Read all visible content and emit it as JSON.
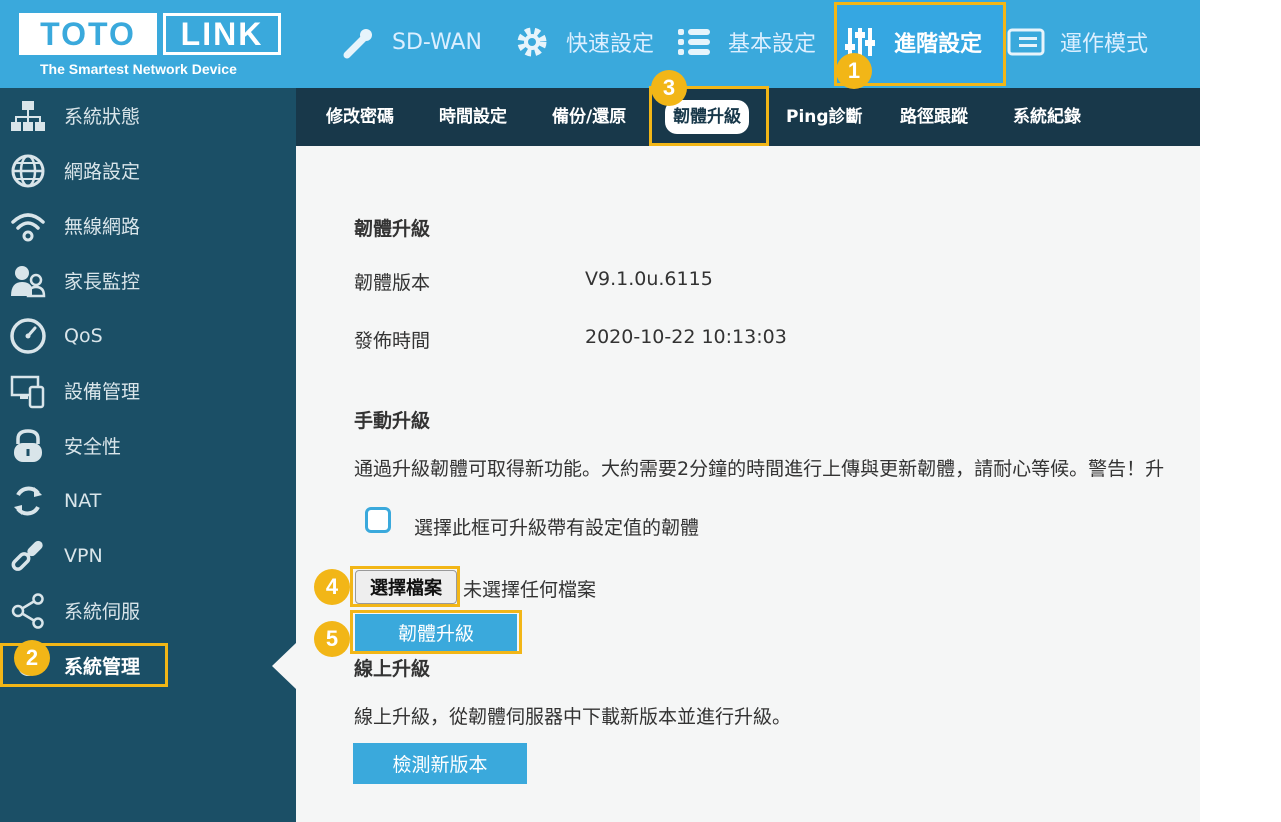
{
  "brand": {
    "logo_left": "TOTO",
    "logo_right": "LINK",
    "tagline": "The Smartest Network Device"
  },
  "topnav": [
    {
      "label": "SD-WAN",
      "icon": "wrench-icon"
    },
    {
      "label": "快速設定",
      "icon": "gear-icon"
    },
    {
      "label": "基本設定",
      "icon": "list-icon"
    },
    {
      "label": "進階設定",
      "icon": "sliders-icon",
      "active": true
    },
    {
      "label": "運作模式",
      "icon": "card-icon"
    }
  ],
  "subnav": [
    {
      "label": "修改密碼"
    },
    {
      "label": "時間設定"
    },
    {
      "label": "備份/還原"
    },
    {
      "label": "韌體升級",
      "active": true
    },
    {
      "label": "Ping診斷"
    },
    {
      "label": "路徑跟蹤"
    },
    {
      "label": "系統紀錄"
    }
  ],
  "sidebar": [
    {
      "label": "系統狀態",
      "icon": "network-icon"
    },
    {
      "label": "網路設定",
      "icon": "globe-icon"
    },
    {
      "label": "無線網路",
      "icon": "wifi-icon"
    },
    {
      "label": "家長監控",
      "icon": "parental-icon"
    },
    {
      "label": "QoS",
      "icon": "gauge-icon"
    },
    {
      "label": "設備管理",
      "icon": "devices-icon"
    },
    {
      "label": "安全性",
      "icon": "lock-icon"
    },
    {
      "label": "NAT",
      "icon": "refresh-icon"
    },
    {
      "label": "VPN",
      "icon": "link-icon"
    },
    {
      "label": "系統伺服",
      "icon": "share-icon"
    },
    {
      "label": "系統管理",
      "icon": "admin-icon",
      "active": true
    }
  ],
  "firmware": {
    "section_title": "韌體升級",
    "version_label": "韌體版本",
    "version_value": "V9.1.0u.6115",
    "date_label": "發佈時間",
    "date_value": "2020-10-22 10:13:03"
  },
  "manual": {
    "section_title": "手動升級",
    "description": "通過升級韌體可取得新功能。大約需要2分鐘的時間進行上傳與更新韌體，請耐心等候。警告！升",
    "checkbox_label": "選擇此框可升級帶有設定值的韌體",
    "file_button": "選擇檔案",
    "file_status": "未選擇任何檔案",
    "upgrade_button": "韌體升級"
  },
  "online": {
    "section_title": "線上升級",
    "description": "線上升級，從韌體伺服器中下載新版本並進行升級。",
    "check_button": "檢測新版本"
  },
  "annotations": [
    "1",
    "2",
    "3",
    "4",
    "5"
  ],
  "colors": {
    "header": "#3aa9dc",
    "sidebar": "#1b4f66",
    "subnav": "#18384a",
    "highlight": "#f2b617",
    "button": "#3aa9dc"
  }
}
